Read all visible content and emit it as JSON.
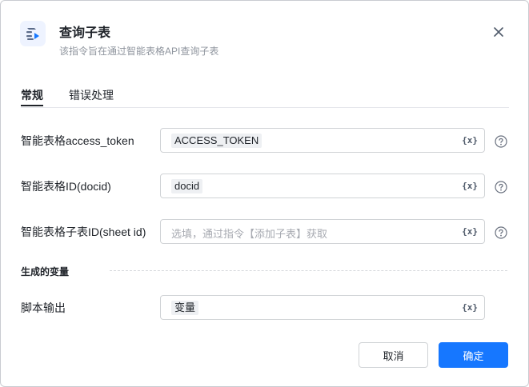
{
  "dialog": {
    "title": "查询子表",
    "subtitle": "该指令旨在通过智能表格API查询子表",
    "icon": "table-query-icon",
    "accent": "#1677ff"
  },
  "tabs": [
    {
      "label": "常规",
      "active": true
    },
    {
      "label": "错误处理",
      "active": false
    }
  ],
  "fields": [
    {
      "label": "智能表格access_token",
      "value": "ACCESS_TOKEN",
      "placeholder": ""
    },
    {
      "label": "智能表格ID(docid)",
      "value": "docid",
      "placeholder": ""
    },
    {
      "label": "智能表格子表ID(sheet id)",
      "value": "",
      "placeholder": "选填，通过指令【添加子表】获取"
    }
  ],
  "variable_icon_label": "{x}",
  "output_section": {
    "title": "生成的变量",
    "label": "脚本输出",
    "value": "变量"
  },
  "buttons": {
    "cancel": "取消",
    "confirm": "确定"
  }
}
